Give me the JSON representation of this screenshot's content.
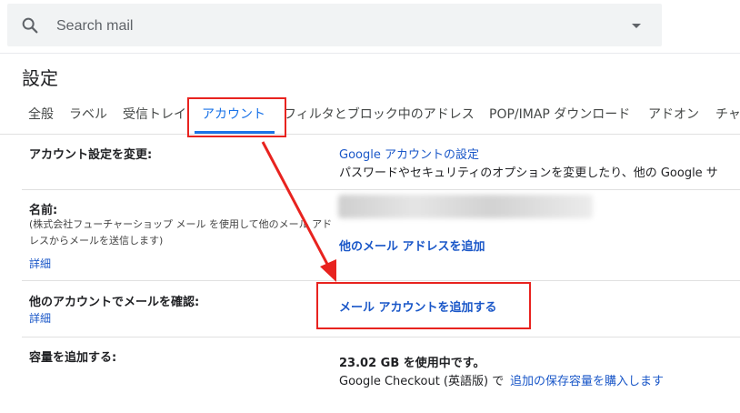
{
  "search": {
    "placeholder": "Search mail",
    "icon": "search-icon",
    "dropdown_icon": "chevron-down-icon"
  },
  "page": {
    "title": "設定"
  },
  "tabs": [
    {
      "label": "全般"
    },
    {
      "label": "ラベル"
    },
    {
      "label": "受信トレイ"
    },
    {
      "label": "アカウント",
      "active": true
    },
    {
      "label": "フィルタとブロック中のアドレス"
    },
    {
      "label": "POP/IMAP ダウンロード"
    },
    {
      "label": "アドオン"
    },
    {
      "label": "チャ"
    }
  ],
  "rows": {
    "change": {
      "label": "アカウント設定を変更:",
      "link": "Google アカウントの設定",
      "desc": "パスワードやセキュリティのオプションを変更したり、他の Google サ"
    },
    "name": {
      "label": "名前:",
      "sub": "(株式会社フューチャーショップ メール を使用して他のメール アドレスからメールを送信します)",
      "details": "詳細",
      "action": "他のメール アドレスを追加"
    },
    "check": {
      "label": "他のアカウントでメールを確認:",
      "details": "詳細",
      "action": "メール アカウントを追加する"
    },
    "storage": {
      "label": "容量を追加する:",
      "usage": "23.02 GB を使用中です。",
      "note": "Google Checkout (英語版) で",
      "link": "追加の保存容量を購入します"
    }
  },
  "colors": {
    "accent": "#1a73e8",
    "link": "#1a57c8",
    "annotation": "#e8231f"
  }
}
